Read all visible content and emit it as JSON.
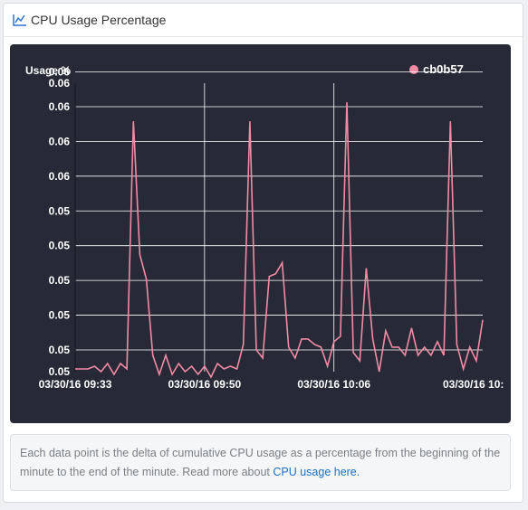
{
  "header": {
    "title": "CPU Usage Percentage",
    "icon": "line-chart-icon"
  },
  "chart_data": {
    "type": "line",
    "ylabel": "Usage %",
    "grid": true,
    "legend_position": "top-right",
    "y_tick_labels": [
      "0.05",
      "0.05",
      "0.05",
      "0.05",
      "0.05",
      "0.05",
      "0.06",
      "0.06",
      "0.06",
      "0.06",
      "0.06"
    ],
    "x_tick_labels": [
      "03/30/16 09:33",
      "03/30/16 09:50",
      "03/30/16 10:06",
      "03/30/16 10:"
    ],
    "ylim": [
      0.05,
      0.0606
    ],
    "series": [
      {
        "name": "cb0b57",
        "color": "#f28aa6",
        "values": [
          0.0501,
          0.0501,
          0.0501,
          0.0502,
          0.05,
          0.0503,
          0.0499,
          0.0503,
          0.0501,
          0.0592,
          0.0543,
          0.0534,
          0.0506,
          0.0499,
          0.0506,
          0.0499,
          0.0503,
          0.05,
          0.0502,
          0.0499,
          0.0502,
          0.0498,
          0.0503,
          0.0501,
          0.0502,
          0.0501,
          0.051,
          0.0592,
          0.0508,
          0.0505,
          0.0535,
          0.0536,
          0.054,
          0.0509,
          0.0505,
          0.0512,
          0.0512,
          0.051,
          0.0509,
          0.0502,
          0.0511,
          0.0513,
          0.0599,
          0.0507,
          0.0504,
          0.0538,
          0.0512,
          0.05,
          0.0515,
          0.0509,
          0.0509,
          0.0506,
          0.0516,
          0.0506,
          0.0509,
          0.0506,
          0.0511,
          0.0506,
          0.0592,
          0.051,
          0.0501,
          0.0509,
          0.0504,
          0.0519
        ]
      }
    ]
  },
  "note": {
    "text": "Each data point is the delta of cumulative CPU usage as a percentage from the beginning of the minute to the end of the minute. Read more about ",
    "link": "CPU usage here."
  }
}
